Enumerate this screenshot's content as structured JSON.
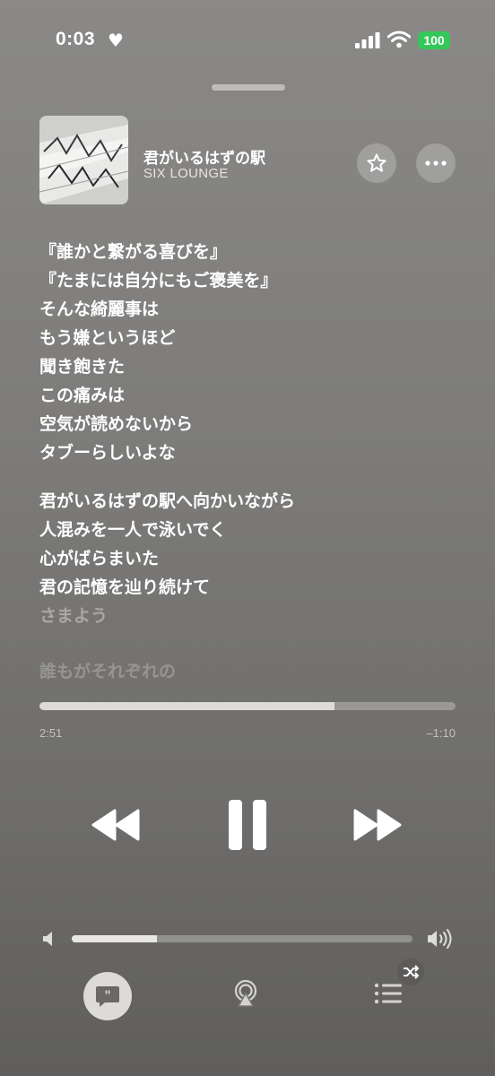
{
  "status_bar": {
    "time": "0:03",
    "battery": "100",
    "battery_color": "#35c759"
  },
  "now_playing": {
    "title": "君がいるはずの駅",
    "artist": "SIX LOUNGE",
    "favorite_icon": "star-icon",
    "more_icon": "ellipsis-icon"
  },
  "lyrics": {
    "stanza1": [
      "『誰かと繋がる喜びを』",
      "『たまには自分にもご褒美を』",
      "そんな綺麗事は",
      "もう嫌というほど",
      "聞き飽きた",
      "この痛みは",
      "空気が読めないから",
      "タブーらしいよな"
    ],
    "stanza2": [
      "君がいるはずの駅へ向かいながら",
      "人混みを一人で泳いでく",
      "心がばらまいた",
      "君の記憶を辿り続けて",
      "さまよう"
    ],
    "upcoming": "誰もがそれぞれの"
  },
  "playback": {
    "elapsed": "2:51",
    "remaining": "–1:10",
    "progress": 0.71
  },
  "volume": {
    "level": 0.25
  }
}
